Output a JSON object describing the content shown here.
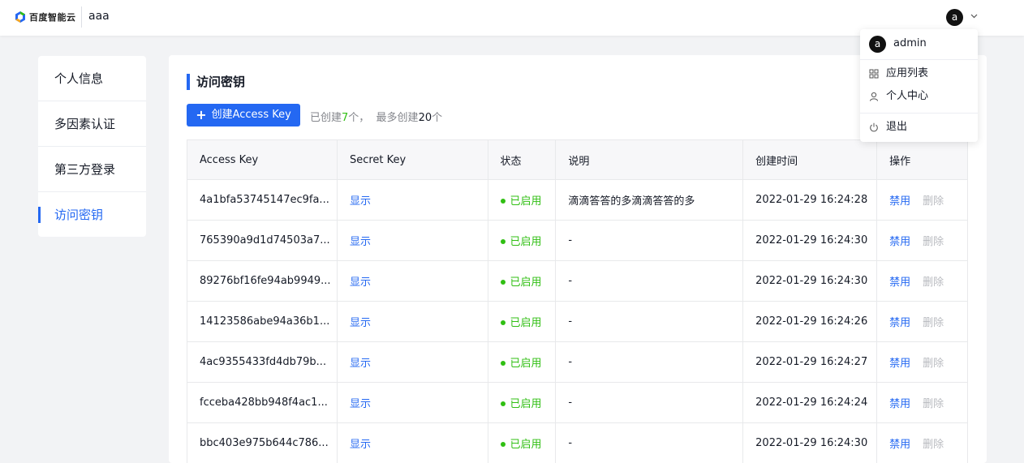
{
  "header": {
    "logo_text": "百度智能云",
    "tenant": "aaa",
    "avatar_letter": "a"
  },
  "sidebar": {
    "items": [
      {
        "label": "个人信息"
      },
      {
        "label": "多因素认证"
      },
      {
        "label": "第三方登录"
      },
      {
        "label": "访问密钥",
        "active": true
      }
    ]
  },
  "main": {
    "title": "访问密钥",
    "create_button": "创建Access Key",
    "quota_prefix": "已创建",
    "quota_created": "7",
    "quota_mid": "个，  最多创建",
    "quota_max": "20",
    "quota_suffix": "个"
  },
  "table": {
    "headers": [
      "Access Key",
      "Secret Key",
      "状态",
      "说明",
      "创建时间",
      "操作"
    ],
    "show_label": "显示",
    "status_label": "已启用",
    "action_disable": "禁用",
    "action_delete": "删除",
    "rows": [
      {
        "access_key": "4a1bfa53745147ec9fa...",
        "desc": "滴滴答答的多滴滴答答的多",
        "created": "2022-01-29 16:24:28"
      },
      {
        "access_key": "765390a9d1d74503a7...",
        "desc": "-",
        "created": "2022-01-29 16:24:30"
      },
      {
        "access_key": "89276bf16fe94ab9949...",
        "desc": "-",
        "created": "2022-01-29 16:24:30"
      },
      {
        "access_key": "14123586abe94a36b1...",
        "desc": "-",
        "created": "2022-01-29 16:24:26"
      },
      {
        "access_key": "4ac9355433fd4db79b...",
        "desc": "-",
        "created": "2022-01-29 16:24:27"
      },
      {
        "access_key": "fcceba428bb948f4ac1...",
        "desc": "-",
        "created": "2022-01-29 16:24:24"
      },
      {
        "access_key": "bbc403e975b644c786...",
        "desc": "-",
        "created": "2022-01-29 16:24:30"
      }
    ]
  },
  "user_menu": {
    "username": "admin",
    "items": [
      {
        "label": "应用列表",
        "icon": "grid-icon"
      },
      {
        "label": "个人中心",
        "icon": "user-icon"
      },
      {
        "label": "退出",
        "icon": "power-icon"
      }
    ]
  },
  "colors": {
    "accent": "#2468f2",
    "success": "#30bf13",
    "muted": "#b8babf"
  }
}
